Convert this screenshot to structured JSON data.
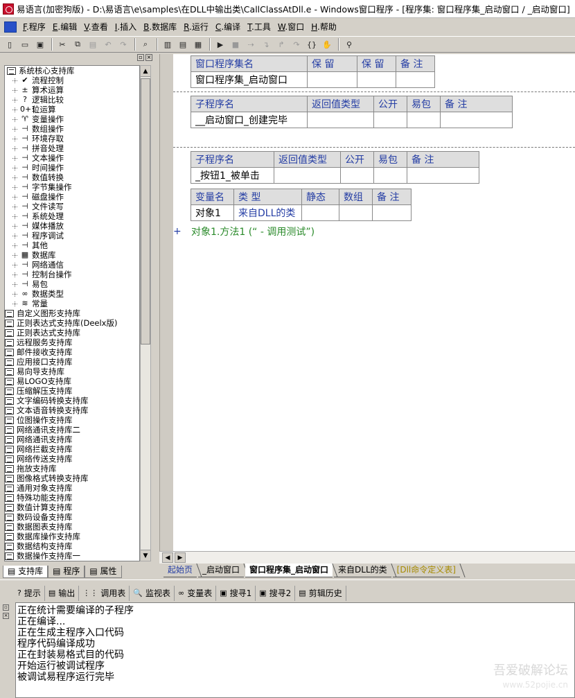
{
  "window": {
    "title": "易语言(加密狗版) - D:\\易语言\\e\\samples\\在DLL中输出类\\CallClassAtDll.e - Windows窗口程序 - [程序集: 窗口程序集_启动窗口 / _启动窗口]"
  },
  "menu": [
    {
      "key": "F",
      "label": ".程序"
    },
    {
      "key": "E",
      "label": ".编辑"
    },
    {
      "key": "V",
      "label": ".查看"
    },
    {
      "key": "I",
      "label": ".插入"
    },
    {
      "key": "B",
      "label": ".数据库"
    },
    {
      "key": "R",
      "label": ".运行"
    },
    {
      "key": "C",
      "label": ".编译"
    },
    {
      "key": "T",
      "label": ".工具"
    },
    {
      "key": "W",
      "label": ".窗口"
    },
    {
      "key": "H",
      "label": ".帮助"
    }
  ],
  "toolbar": {
    "icons": [
      "new-file-icon",
      "open-folder-icon",
      "save-icon",
      "cut-icon",
      "copy-icon",
      "paste-icon",
      "undo-icon",
      "redo-icon",
      "find-icon",
      "layout-1-icon",
      "layout-2-icon",
      "layout-3-icon",
      "run-icon",
      "stop-icon",
      "step-icon",
      "step-into-icon",
      "step-out-icon",
      "step-over-icon",
      "breakpoint-icon",
      "hand-icon",
      "search-tool-icon"
    ]
  },
  "library_tree": {
    "root": "系统核心支持库",
    "categories": [
      {
        "icon": "✔",
        "label": "流程控制"
      },
      {
        "icon": "±",
        "label": "算术运算"
      },
      {
        "icon": "?",
        "label": "逻辑比较"
      },
      {
        "icon": "0+1",
        "label": "位运算"
      },
      {
        "icon": "♈",
        "label": "变量操作"
      },
      {
        "icon": "⊣",
        "label": "数组操作"
      },
      {
        "icon": "⊣",
        "label": "环境存取"
      },
      {
        "icon": "⊣",
        "label": "拼音处理"
      },
      {
        "icon": "⊣",
        "label": "文本操作"
      },
      {
        "icon": "⊣",
        "label": "时间操作"
      },
      {
        "icon": "⊣",
        "label": "数值转换"
      },
      {
        "icon": "⊣",
        "label": "字节集操作"
      },
      {
        "icon": "⊣",
        "label": "磁盘操作"
      },
      {
        "icon": "⊣",
        "label": "文件读写"
      },
      {
        "icon": "⊣",
        "label": "系统处理"
      },
      {
        "icon": "⊣",
        "label": "媒体播放"
      },
      {
        "icon": "⊣",
        "label": "程序调试"
      },
      {
        "icon": "⊣",
        "label": "其他"
      },
      {
        "icon": "▦",
        "label": "数据库"
      },
      {
        "icon": "⊣",
        "label": "网络通信"
      },
      {
        "icon": "⊣",
        "label": "控制台操作"
      },
      {
        "icon": "⊣",
        "label": "易包"
      },
      {
        "icon": "∞",
        "label": "数据类型"
      },
      {
        "icon": "≋",
        "label": "常量"
      }
    ],
    "libraries": [
      "自定义图形支持库",
      "正则表达式支持库(Deelx版)",
      "正则表达式支持库",
      "远程服务支持库",
      "邮件接收支持库",
      "应用接口支持库",
      "易向导支持库",
      "易LOGO支持库",
      "压缩解压支持库",
      "文字编码转换支持库",
      "文本语音转换支持库",
      "位图操作支持库",
      "网络通讯支持库二",
      "网络通讯支持库",
      "网络拦截支持库",
      "网络传送支持库",
      "拖放支持库",
      "图像格式转换支持库",
      "通用对象支持库",
      "特殊功能支持库",
      "数值计算支持库",
      "数码设备支持库",
      "数据图表支持库",
      "数据库操作支持库",
      "数据结构支持库",
      "数据操作支持库一"
    ]
  },
  "left_tabs": [
    {
      "label": "支持库",
      "icon": "library-tab-icon"
    },
    {
      "label": "程序",
      "icon": "program-tab-icon"
    },
    {
      "label": "属性",
      "icon": "property-tab-icon"
    }
  ],
  "editor": {
    "assembly_table": {
      "headers": [
        "窗口程序集名",
        "保 留",
        "保 留",
        "备 注"
      ],
      "row": [
        "窗口程序集_启动窗口",
        "",
        "",
        ""
      ]
    },
    "sub1_table": {
      "headers": [
        "子程序名",
        "返回值类型",
        "公开",
        "易包",
        "备 注"
      ],
      "row": [
        "__启动窗口_创建完毕",
        "",
        "",
        "",
        ""
      ]
    },
    "sub2_table": {
      "headers": [
        "子程序名",
        "返回值类型",
        "公开",
        "易包",
        "备 注"
      ],
      "row": [
        "_按钮1_被单击",
        "",
        "",
        "",
        ""
      ]
    },
    "var_table": {
      "headers": [
        "变量名",
        "类 型",
        "静态",
        "数组",
        "备 注"
      ],
      "row": [
        "对象1",
        "来自DLL的类",
        "",
        "",
        ""
      ]
    },
    "code_line": "对象1.方法1 (“ - 调用测试”)",
    "code_prefix": "+"
  },
  "editor_tabs": [
    {
      "label": "起始页",
      "style": "blue"
    },
    {
      "label": "_启动窗口",
      "style": "normal"
    },
    {
      "label": "窗口程序集_启动窗口",
      "style": "active"
    },
    {
      "label": "来自DLL的类",
      "style": "normal"
    },
    {
      "label": "[Dll命令定义表]",
      "style": "gold"
    }
  ],
  "bottom_tabs": [
    {
      "label": "提示",
      "icon": "hint-icon",
      "glyph": "?"
    },
    {
      "label": "输出",
      "icon": "output-icon",
      "glyph": "▤"
    },
    {
      "label": "调用表",
      "icon": "call-table-icon",
      "glyph": "⋮⋮"
    },
    {
      "label": "监视表",
      "icon": "watch-icon",
      "glyph": "🔍"
    },
    {
      "label": "变量表",
      "icon": "variable-icon",
      "glyph": "∞"
    },
    {
      "label": "搜寻1",
      "icon": "search1-icon",
      "glyph": "▣"
    },
    {
      "label": "搜寻2",
      "icon": "search2-icon",
      "glyph": "▣"
    },
    {
      "label": "剪辑历史",
      "icon": "clip-history-icon",
      "glyph": "▤"
    }
  ],
  "output_lines": [
    "正在统计需要编译的子程序",
    "正在编译...",
    "正在生成主程序入口代码",
    "程序代码编译成功",
    "正在封装易格式目的代码",
    "开始运行被调试程序",
    "被调试易程序运行完毕"
  ],
  "watermark": {
    "line1": "吾爱破解论坛",
    "line2": "www.52pojie.cn"
  }
}
